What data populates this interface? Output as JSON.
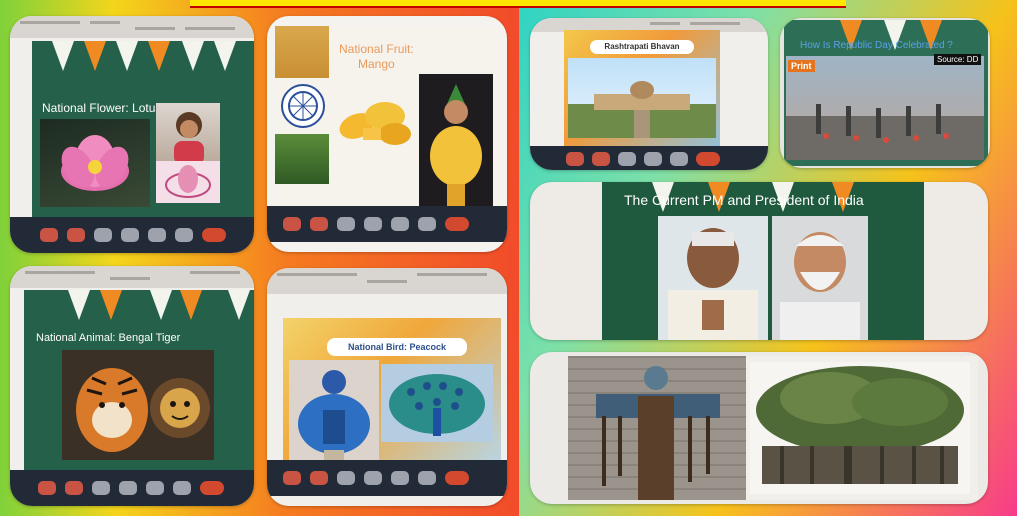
{
  "panels": {
    "lotus": {
      "title": "National Flower: Lotus"
    },
    "mango": {
      "title": "National Fruit:\nMango"
    },
    "tiger": {
      "title": "National Animal: Bengal Tiger"
    },
    "peacock": {
      "title": "National Bird: Peacock"
    },
    "bhavan": {
      "title": "Rashtrapati Bhavan"
    },
    "republic": {
      "title": "How Is Republic Day Celebrated ?",
      "source": "Source: DD",
      "logo": "Print"
    },
    "pm": {
      "title": "The Current PM and President of India"
    }
  },
  "colors": {
    "accent_orange": "#f08a22",
    "slide_green": "#24604a",
    "call_end_red": "#d3492f",
    "toolbar_dark": "#222a38"
  }
}
